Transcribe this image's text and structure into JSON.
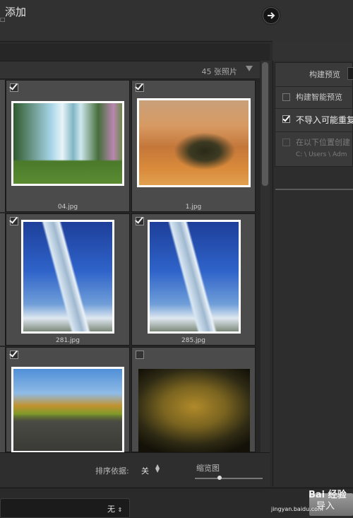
{
  "header": {
    "title": "添加",
    "subtitle": "□"
  },
  "grid": {
    "photo_count": "45 张照片",
    "items": [
      {
        "filename": "04.jpg",
        "checked": true
      },
      {
        "filename": "1.jpg",
        "checked": true
      },
      {
        "filename": "281.jpg",
        "checked": true
      },
      {
        "filename": "285.jpg",
        "checked": true
      },
      {
        "filename": "",
        "checked": true
      },
      {
        "filename": "",
        "checked": false
      }
    ]
  },
  "footer": {
    "sort_label": "排序依据:",
    "sort_value": "关",
    "thumbnail_label": "缩览图",
    "thumbnail_size": 0.36
  },
  "right_panel": {
    "build_preview_label": "构建预览",
    "smart_preview_label": "构建智能预览",
    "smart_preview_checked": false,
    "no_duplicates_label": "不导入可能重复",
    "no_duplicates_checked": true,
    "backup_label": "在以下位置创建",
    "backup_checked": false,
    "backup_path": "C: \\ Users \\ Adm"
  },
  "bottom": {
    "destination_value": "无",
    "import_label": "导入"
  },
  "watermark": {
    "text": "Bai 经验",
    "url": "jingyan.baidu.com"
  },
  "colors": {
    "background": "#2b2b2b",
    "cell": "#4b4b4b",
    "import_button": "#8a8a8a"
  }
}
